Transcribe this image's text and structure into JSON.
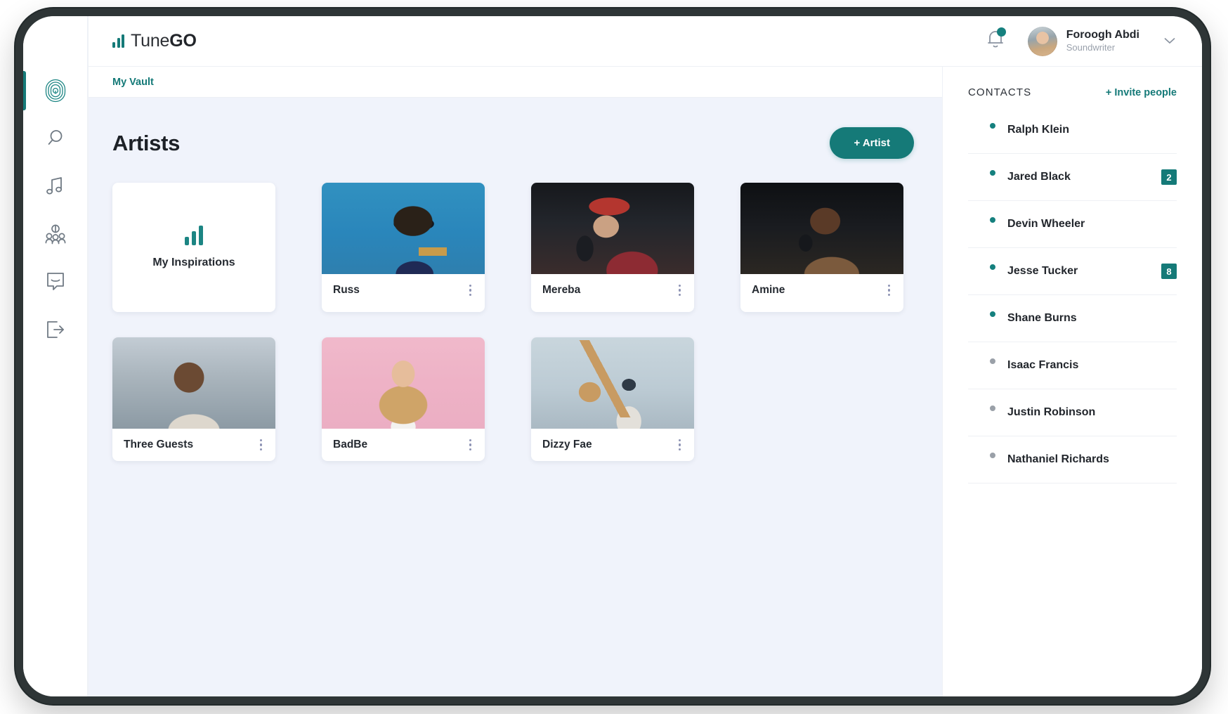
{
  "app": {
    "logo_text_light": "Tune",
    "logo_text_bold": "GO",
    "logo_icon": "bar-chart-icon"
  },
  "header": {
    "notifications_icon": "bell-icon",
    "user_name": "Foroogh Abdi",
    "user_role": "Soundwriter",
    "caret_icon": "chevron-down-icon"
  },
  "sidebar": {
    "items": [
      {
        "name": "vault",
        "icon": "fingerprint-icon",
        "active": true
      },
      {
        "name": "search",
        "icon": "search-icon",
        "active": false
      },
      {
        "name": "music",
        "icon": "music-note-icon",
        "active": false
      },
      {
        "name": "people",
        "icon": "people-group-icon",
        "active": false
      },
      {
        "name": "messages",
        "icon": "chat-bubble-icon",
        "active": false
      },
      {
        "name": "logout",
        "icon": "logout-icon",
        "active": false
      }
    ]
  },
  "breadcrumb": {
    "label": "My Vault"
  },
  "main": {
    "title": "Artists",
    "add_button": "+ Artist",
    "inspirations": {
      "label": "My Inspirations",
      "icon": "bar-chart-icon"
    },
    "artists": [
      {
        "name": "Russ",
        "thumb": "t-russ",
        "menu_icon": "kebab-menu-icon"
      },
      {
        "name": "Mereba",
        "thumb": "t-mereba",
        "menu_icon": "kebab-menu-icon"
      },
      {
        "name": "Amine",
        "thumb": "t-amine",
        "menu_icon": "kebab-menu-icon"
      },
      {
        "name": "Three Guests",
        "thumb": "t-three",
        "menu_icon": "kebab-menu-icon"
      },
      {
        "name": "BadBe",
        "thumb": "t-badbe",
        "menu_icon": "kebab-menu-icon"
      },
      {
        "name": "Dizzy Fae",
        "thumb": "t-dizzy",
        "menu_icon": "kebab-menu-icon"
      }
    ]
  },
  "contacts": {
    "title": "CONTACTS",
    "invite_label": "+ Invite people",
    "items": [
      {
        "name": "Ralph Klein",
        "status": "online",
        "badge": "",
        "avatar": "av-ralph"
      },
      {
        "name": "Jared Black",
        "status": "online",
        "badge": "2",
        "avatar": "av-jared"
      },
      {
        "name": "Devin Wheeler",
        "status": "online",
        "badge": "",
        "avatar": "av-devin"
      },
      {
        "name": "Jesse Tucker",
        "status": "online",
        "badge": "8",
        "avatar": "av-jesse"
      },
      {
        "name": "Shane Burns",
        "status": "online",
        "badge": "",
        "avatar": "av-shane"
      },
      {
        "name": "Isaac Francis",
        "status": "offline",
        "badge": "",
        "avatar": "av-isaac"
      },
      {
        "name": "Justin Robinson",
        "status": "offline",
        "badge": "",
        "avatar": "av-justin"
      },
      {
        "name": "Nathaniel Richards",
        "status": "offline",
        "badge": "",
        "avatar": "av-nathaniel"
      }
    ]
  },
  "colors": {
    "accent_teal": "#157a78",
    "page_bg": "#f0f3fb",
    "text_dark": "#22262c",
    "status_online": "#15807e",
    "status_offline": "#9aa0a8"
  }
}
